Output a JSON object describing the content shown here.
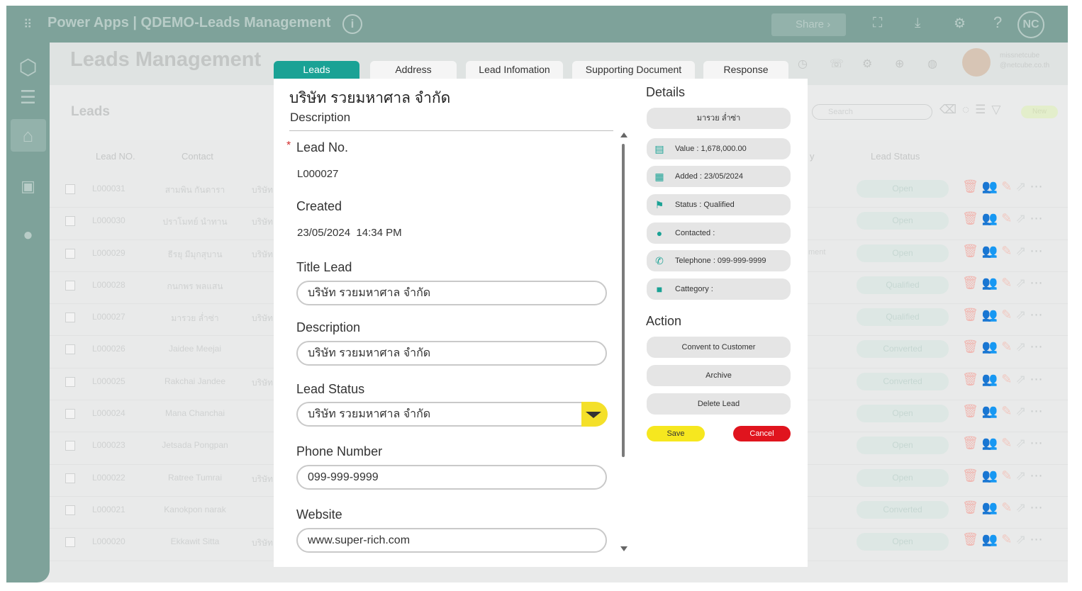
{
  "app": {
    "title": "Power Apps | QDEMO-Leads Management",
    "share_label": "Share",
    "user_initials": "NC",
    "grid_icon": "app-launcher-icon"
  },
  "header": {
    "title": "Leads Management",
    "user_name": "missnetcube",
    "user_email": "@netcube.co.th"
  },
  "leads_panel": {
    "title": "Leads",
    "search_placeholder": "Search",
    "new_label": "New"
  },
  "columns": {
    "lead_no": "Lead NO.",
    "contact": "Contact",
    "category": "y",
    "lead_status": "Lead Status"
  },
  "rows": [
    {
      "no": "L000031",
      "contact": "สามพิน กันดารา",
      "company": "บริษัท",
      "category": "",
      "status": "Open"
    },
    {
      "no": "L000030",
      "contact": "ปราโมทย์ นำทาน",
      "company": "บริษัท",
      "category": "",
      "status": "Open"
    },
    {
      "no": "L000029",
      "contact": "ธีรยุ มีมุกสุบาน",
      "company": "บริษัท",
      "category": "ment",
      "status": "Open"
    },
    {
      "no": "L000028",
      "contact": "กนกพร พลแสน",
      "company": "",
      "category": "",
      "status": "Qualified"
    },
    {
      "no": "L000027",
      "contact": "มารวย ล่ำซ่า",
      "company": "บริษัท",
      "category": "",
      "status": "Qualified"
    },
    {
      "no": "L000026",
      "contact": "Jaidee Meejai",
      "company": "",
      "category": "",
      "status": "Converted"
    },
    {
      "no": "L000025",
      "contact": "Rakchai Jandee",
      "company": "บริษัท",
      "category": "",
      "status": "Converted"
    },
    {
      "no": "L000024",
      "contact": "Mana Chanchai",
      "company": "",
      "category": "",
      "status": "Open"
    },
    {
      "no": "L000023",
      "contact": "Jetsada Pongpan",
      "company": "",
      "category": "",
      "status": "Open"
    },
    {
      "no": "L000022",
      "contact": "Ratree Tumrai",
      "company": "บริษัท",
      "category": "",
      "status": "Open"
    },
    {
      "no": "L000021",
      "contact": "Kanokpon narak",
      "company": "",
      "category": "",
      "status": "Converted"
    },
    {
      "no": "L000020",
      "contact": "Ekkawit Sitta",
      "company": "บริษัท",
      "category": "",
      "status": "Open"
    }
  ],
  "tabs": [
    "Leads",
    "Address",
    "Lead Infomation",
    "Supporting Document",
    "Response"
  ],
  "modal": {
    "company_name": "บริษัท รวยมหาศาล จำกัด",
    "section_title": "Description",
    "required_mark": "*",
    "fields": {
      "lead_no_label": "Lead No.",
      "lead_no_value": "L000027",
      "created_label": "Created",
      "created_value": "23/05/2024  14:34 PM",
      "title_label": "Title Lead",
      "title_value": "บริษัท รวยมหาศาล จำกัด",
      "description_label": "Description",
      "description_value": "บริษัท รวยมหาศาล จำกัด",
      "status_label": "Lead Status",
      "status_value": "บริษัท รวยมหาศาล จำกัด",
      "phone_label": "Phone Number",
      "phone_value": "099-999-9999",
      "website_label": "Website",
      "website_value": "www.super-rich.com"
    },
    "details_title": "Details",
    "details": {
      "contact_name": "มารวย ล่ำซ่า",
      "value": "Value : 1,678,000.00",
      "added": "Added : 23/05/2024",
      "status": "Status : Qualified",
      "contacted": "Contacted :",
      "telephone": "Telephone : 099-999-9999",
      "category": "Cattegory :"
    },
    "action_title": "Action",
    "actions": {
      "convert": "Convent to Customer",
      "archive": "Archive",
      "delete": "Delete Lead",
      "save": "Save",
      "cancel": "Cancel"
    }
  },
  "colors": {
    "accent": "#1aa295",
    "dropdown": "#f4e02a",
    "save": "#f6e71f",
    "cancel": "#e0141e"
  }
}
